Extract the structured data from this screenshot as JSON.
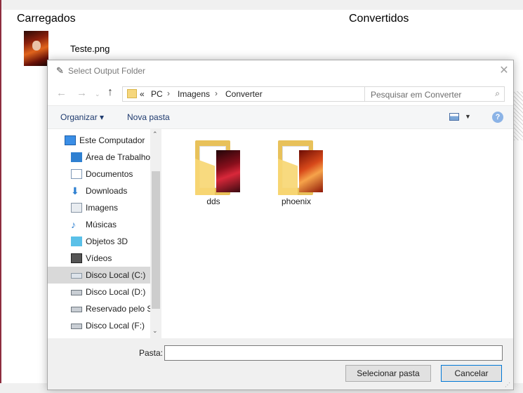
{
  "app": {
    "loaded_heading": "Carregados",
    "converted_heading": "Convertidos",
    "loaded_file": "Teste.png"
  },
  "dialog": {
    "title": "Select Output Folder",
    "close_glyph": "✕",
    "nav": {
      "back": "←",
      "forward": "→",
      "recent": "⌄",
      "up": "↑"
    },
    "breadcrumb": [
      "«",
      "PC",
      "Imagens",
      "Converter"
    ],
    "breadcrumb_sep": "›",
    "search_placeholder": "Pesquisar em Converter",
    "toolbar": {
      "organize": "Organizar ▾",
      "new_folder": "Nova pasta",
      "help": "?"
    },
    "nav_items": [
      {
        "label": "Este Computador",
        "icon": "computer-icon"
      },
      {
        "label": "Área de Trabalho",
        "icon": "desktop-icon"
      },
      {
        "label": "Documentos",
        "icon": "documents-icon"
      },
      {
        "label": "Downloads",
        "icon": "downloads-icon"
      },
      {
        "label": "Imagens",
        "icon": "pictures-icon"
      },
      {
        "label": "Músicas",
        "icon": "music-icon"
      },
      {
        "label": "Objetos 3D",
        "icon": "3d-objects-icon"
      },
      {
        "label": "Vídeos",
        "icon": "videos-icon"
      },
      {
        "label": "Disco Local (C:)",
        "icon": "drive-c-icon",
        "selected": true
      },
      {
        "label": "Disco Local (D:)",
        "icon": "drive-icon"
      },
      {
        "label": "Reservado pelo Si",
        "icon": "drive-icon"
      },
      {
        "label": "Disco Local (F:)",
        "icon": "drive-icon"
      }
    ],
    "folders": [
      {
        "name": "dds"
      },
      {
        "name": "phoenix"
      }
    ],
    "folder_field_label": "Pasta:",
    "folder_field_value": "",
    "select_button": "Selecionar pasta",
    "cancel_button": "Cancelar"
  },
  "colors": {
    "accent": "#0078d7",
    "selection": "#d9d9d9",
    "folder": "#f7d774",
    "app_border": "#8e2d3e"
  }
}
